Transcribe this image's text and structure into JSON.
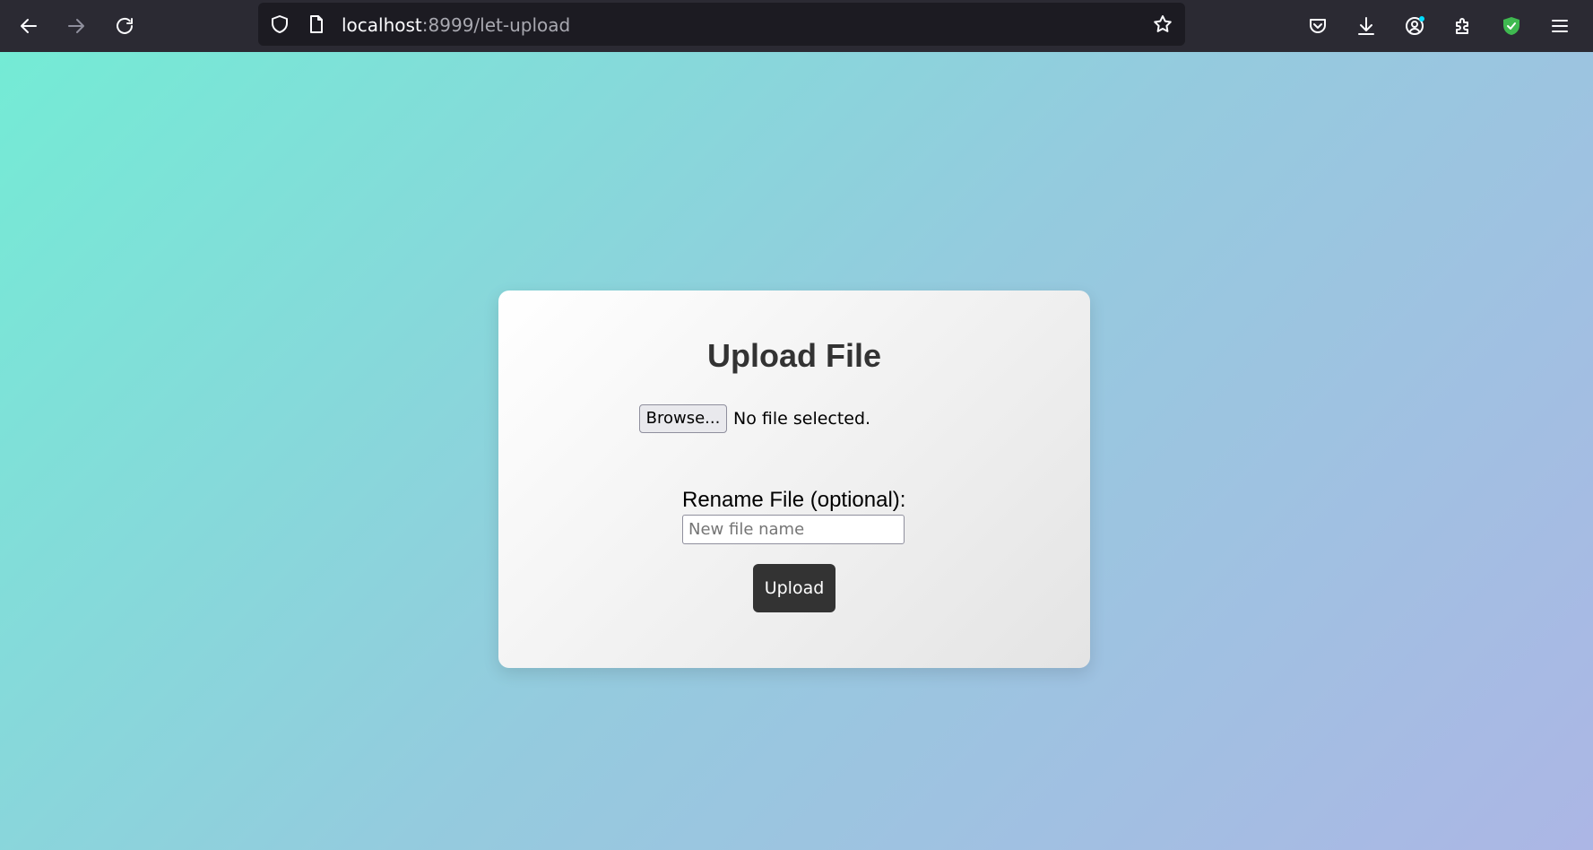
{
  "browser": {
    "url_host": "localhost",
    "url_rest": ":8999/let-upload",
    "icons": {
      "back": "arrow-left-icon",
      "forward": "arrow-right-icon",
      "reload": "reload-icon",
      "tracking": "shield-icon",
      "page": "page-icon",
      "bookmark": "star-icon",
      "pocket": "pocket-icon",
      "downloads": "download-icon",
      "account": "account-icon",
      "extensions": "puzzle-icon",
      "adblock": "green-shield-icon",
      "menu": "hamburger-menu-icon"
    }
  },
  "page": {
    "title": "Upload File",
    "browse_label": "Browse...",
    "no_file_text": "No file selected.",
    "rename_label": "Rename File (optional):",
    "rename_placeholder": "New file name",
    "upload_label": "Upload"
  },
  "colors": {
    "toolbar_bg": "#2b2a33",
    "urlbar_bg": "#1c1b22",
    "gradient_start": "#74ebd5",
    "gradient_end": "#acb6e5",
    "button_dark": "#333333"
  }
}
